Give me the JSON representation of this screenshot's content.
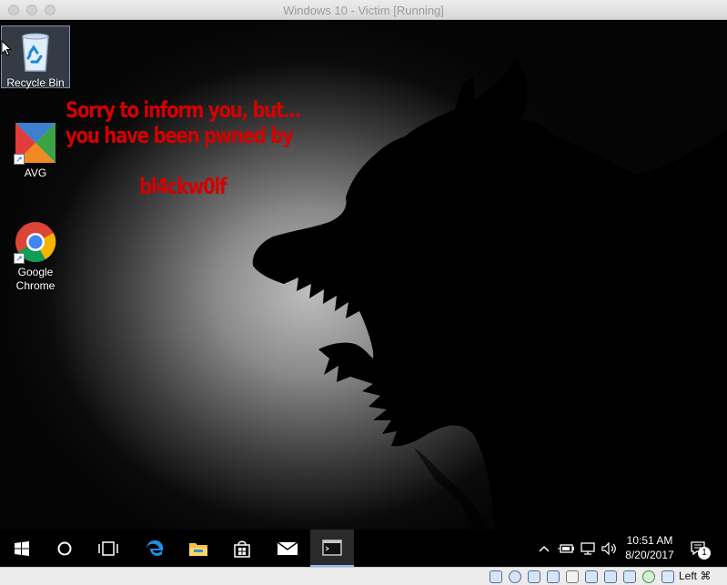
{
  "window": {
    "title": "Windows 10 - Victim [Running]"
  },
  "desktop": {
    "icons": [
      {
        "label": "Recycle Bin"
      },
      {
        "label": "AVG"
      },
      {
        "label": "Google Chrome"
      }
    ],
    "message": {
      "line1": "Sorry to inform you, but...",
      "line2": "you have been pwned by",
      "line3": "bl4ckw0lf",
      "color": "#d40000"
    }
  },
  "taskbar": {
    "clock": {
      "time": "10:51 AM",
      "date": "8/20/2017"
    },
    "notification_count": "1",
    "icons": [
      "windows-start-icon",
      "cortana-search-icon",
      "task-view-icon",
      "edge-icon",
      "file-explorer-icon",
      "store-icon",
      "mail-icon",
      "command-prompt-icon"
    ]
  },
  "statusbar": {
    "host_key": "Left ⌘"
  }
}
